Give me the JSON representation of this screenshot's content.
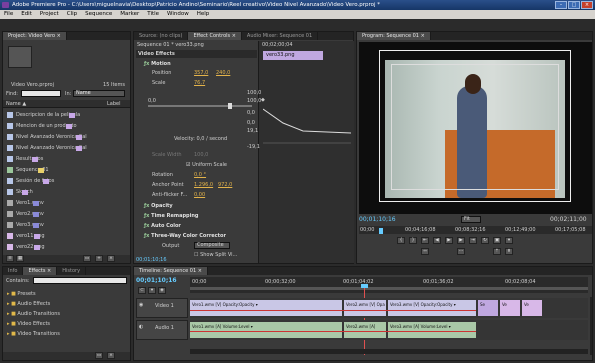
{
  "window": {
    "title": "Adobe Premiere Pro - C:\\Users\\miguelnavia\\Desktop\\Patricio Andino\\Seminario\\Reel creativo\\Video Nivel Avanzado\\Video Vero.prproj *",
    "min": "–",
    "max": "□",
    "close": "×"
  },
  "menu": [
    "File",
    "Edit",
    "Project",
    "Clip",
    "Sequence",
    "Marker",
    "Title",
    "Window",
    "Help"
  ],
  "project": {
    "tab": "Project: Video Vero ×",
    "file_name": "Video Vero.prproj",
    "count": "15 Items",
    "find_label": "Find:",
    "in_label": "In:",
    "in_value": "Name",
    "col_name": "Name ▲",
    "col_label": "Label",
    "items": [
      "Descripcion de la pelicula",
      "Mencion de un producto",
      "Nivel Avanzado Veronica Sal",
      "Nivel Avanzado Veronica Sal",
      "Resultados",
      "Sequence 01",
      "Sesión de fotos",
      "Sketch",
      "Vero1.wmv",
      "Vero2.wmv",
      "Vero3.wmv",
      "vero11.png",
      "vero22.png"
    ]
  },
  "effect_controls": {
    "tabs": [
      "Source: (no clips)",
      "Effect Controls ×",
      "Audio Mixer: Sequence 01"
    ],
    "header": "Sequence 01 * vero33.png",
    "timecode": "00;02;00;04",
    "mini_clip": "vero33.png",
    "section": "Video Effects",
    "motion": "Motion",
    "position_label": "Position",
    "pos_x": "357,0",
    "pos_y": "240,0",
    "scale_label": "Scale",
    "scale_val": "76,7",
    "scale_min": "0,0",
    "scale_max": "100,0",
    "graph_top": "100,0",
    "graph_mid": "0,0",
    "graph_v2": "0,0",
    "graph_v3": "19,1",
    "graph_v4": "-19,1",
    "velocity": "Velocity: 0,0 / second",
    "scale_width": "Scale Width",
    "scale_width_val": "100,0",
    "uniform": "Uniform Scale",
    "rotation": "Rotation",
    "rotation_val": "0,0 °",
    "anchor": "Anchor Point",
    "anchor_x": "1.296,0",
    "anchor_y": "972,0",
    "antiflicker": "Anti-flicker F...",
    "antiflicker_val": "0,00",
    "opacity": "Opacity",
    "time_remap": "Time Remapping",
    "auto_color": "Auto Color",
    "three_way": "Three-Way Color Corrector",
    "output_label": "Output",
    "output_val": "Composite",
    "show_split": "Show Split Vi...",
    "bottom_tc": "00;01;10;16"
  },
  "program": {
    "tab": "Program: Sequence 01 ×",
    "tc_left": "00;01;10;16",
    "fit": "Fit",
    "tc_right": "00;02;11;00",
    "ruler": [
      "00;00",
      "00;04;16;08",
      "00;08;32;16",
      "00;12;49;00",
      "00;17;05;08"
    ]
  },
  "effects": {
    "tabs": [
      "Info",
      "Effects ×",
      "History"
    ],
    "contains": "Contains:",
    "folders": [
      "Presets",
      "Audio Effects",
      "Audio Transitions",
      "Video Effects",
      "Video Transitions"
    ]
  },
  "timeline": {
    "tab": "Timeline: Sequence 01 ×",
    "timecode": "00;01;10;16",
    "ruler": [
      "00;00",
      "00;00;32;00",
      "00;01;04;02",
      "00;01;36;02",
      "00;02;08;04"
    ],
    "video_track": "Video 1",
    "audio_track": "Audio 1",
    "clips_v": [
      "Vero1.wmv [V] Opacity:Opacity ▾",
      "Vero2.wmv [V] Opa",
      "Vero3.wmv [V] Opacity:Opacity ▾",
      "Se",
      "Ve",
      "Ve"
    ],
    "clips_a": [
      "Vero1.wmv [A] Volume:Level ▾",
      "Vero2.wmv [A]",
      "Vero3.wmv [A] Volume:Level ▾"
    ]
  }
}
